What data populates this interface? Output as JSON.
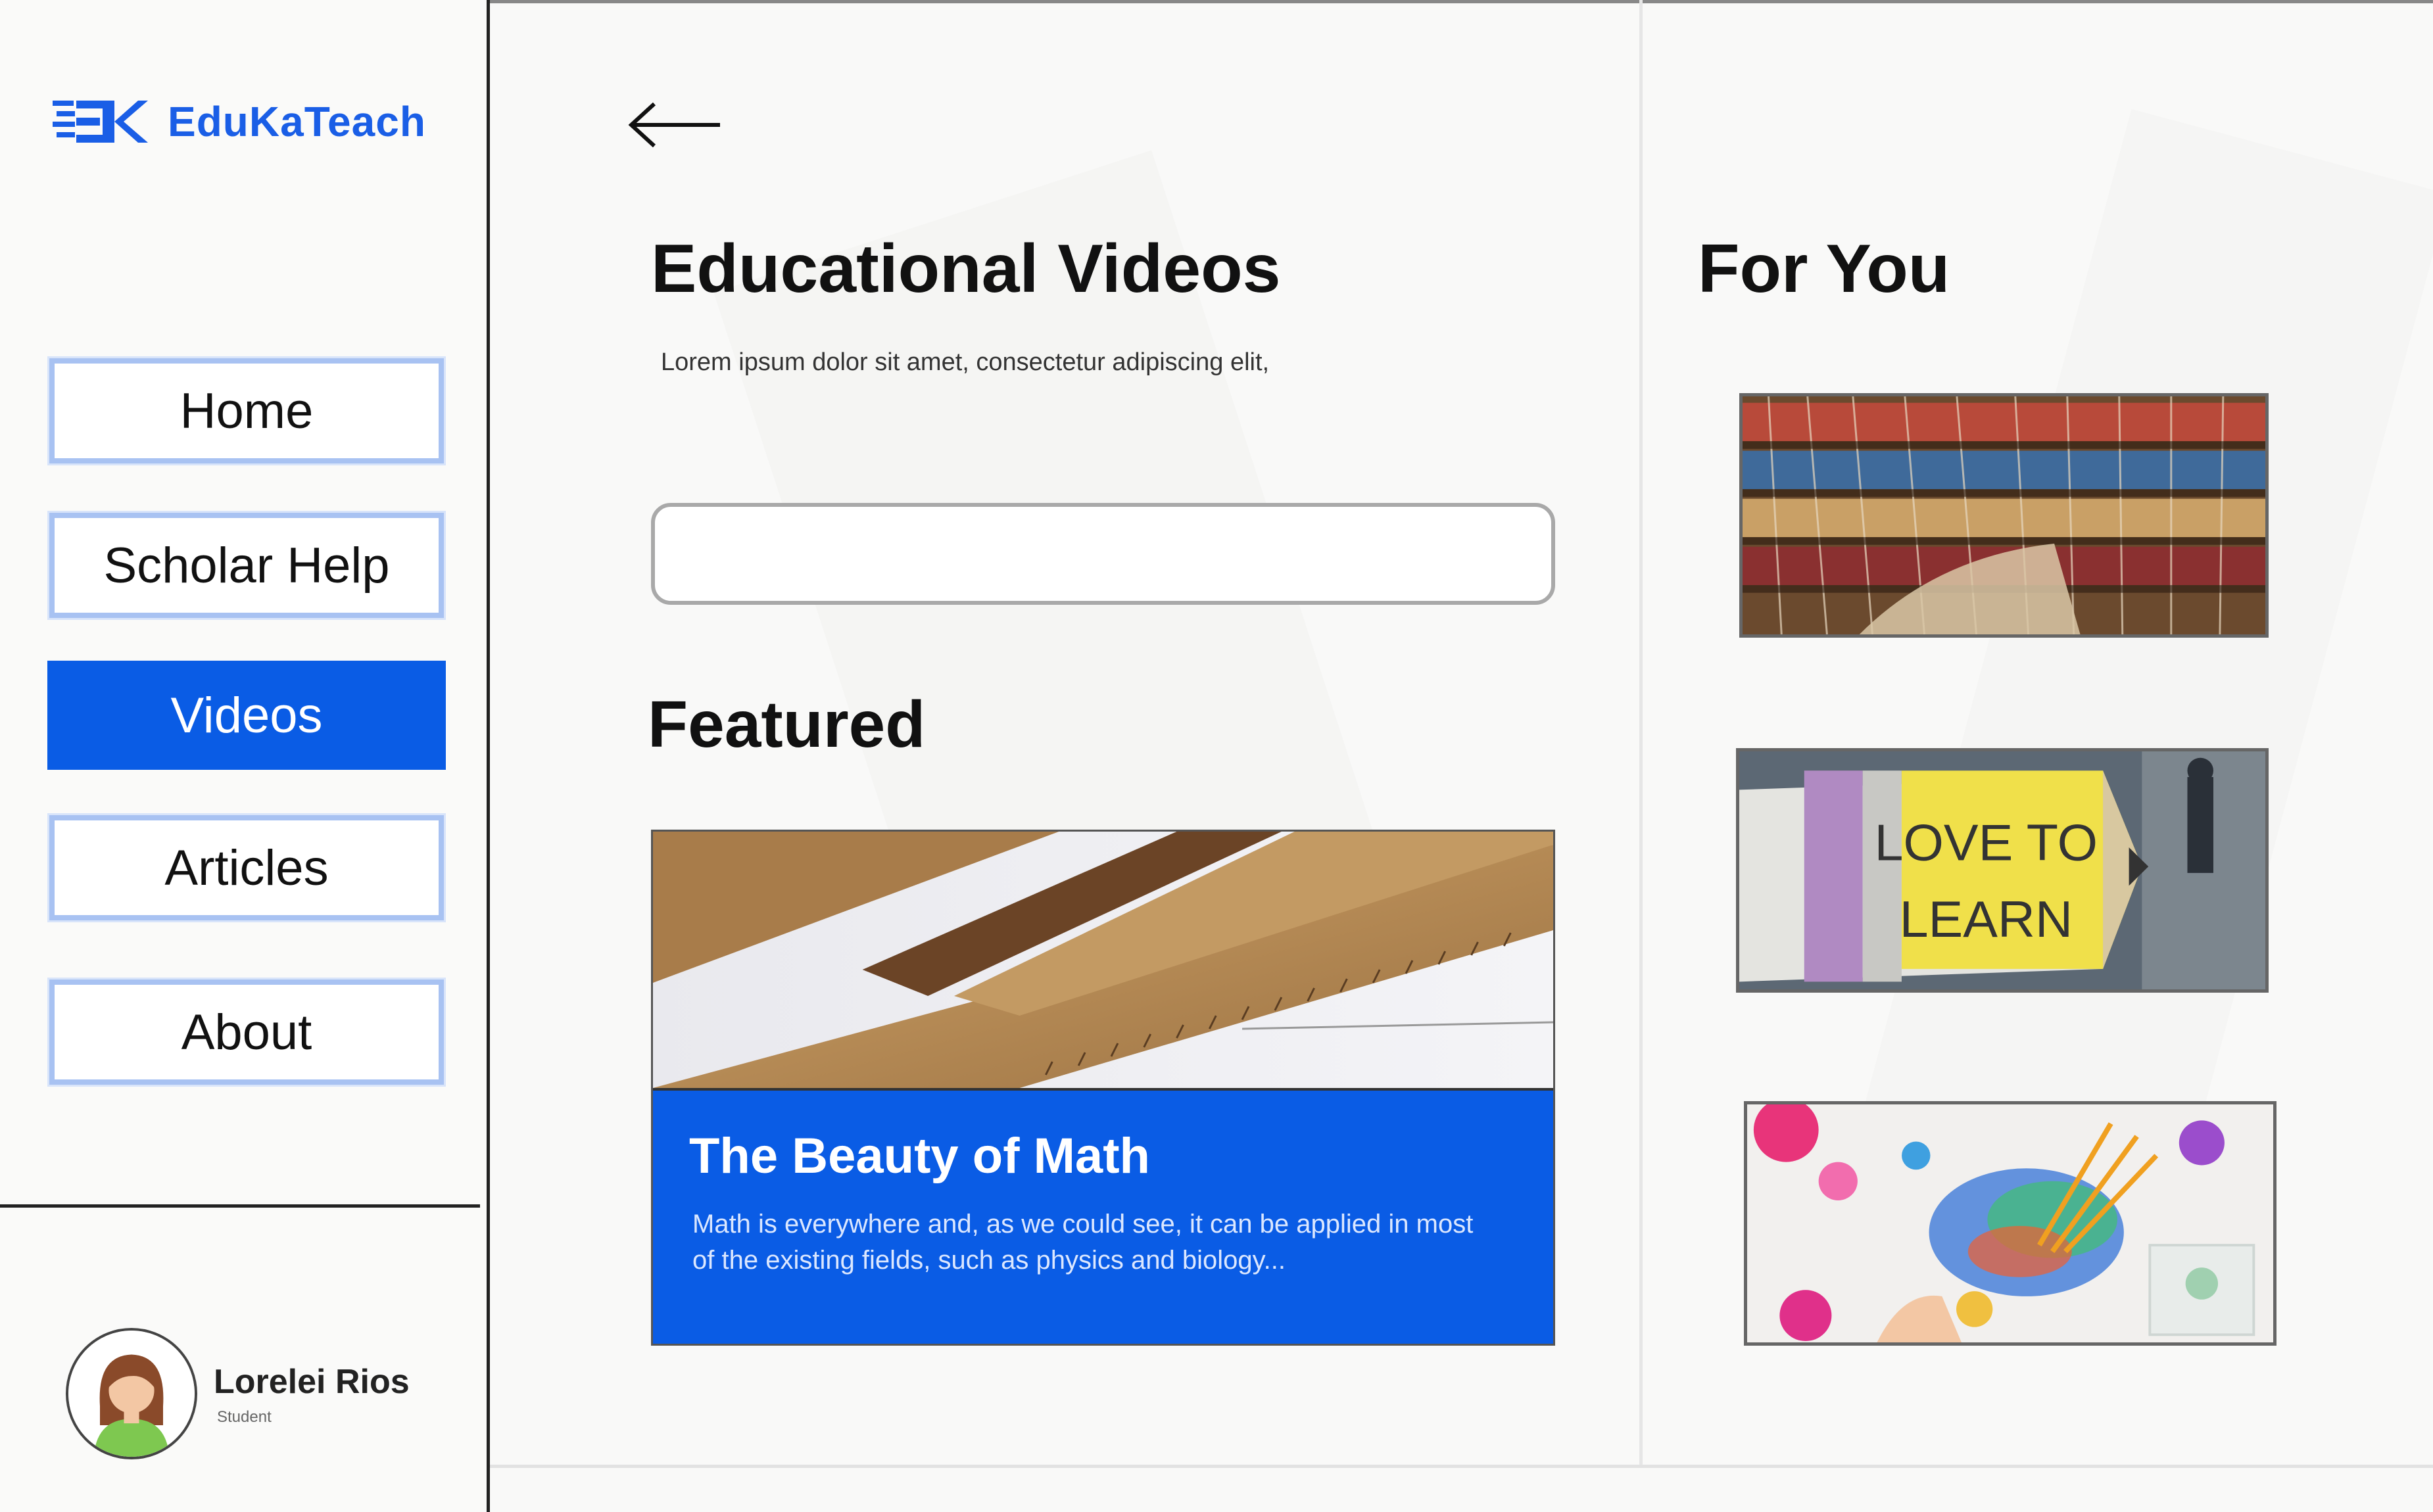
{
  "brand": {
    "name": "EduKaTeach",
    "logo_icon": "ek-logo-icon",
    "color": "#1a5ee6"
  },
  "sidebar": {
    "items": [
      {
        "label": "Home",
        "active": false
      },
      {
        "label": "Scholar  Help",
        "active": false
      },
      {
        "label": "Videos",
        "active": true
      },
      {
        "label": "Articles",
        "active": false
      },
      {
        "label": "About",
        "active": false
      }
    ]
  },
  "user": {
    "name": "Lorelei Rios",
    "role": "Student",
    "avatar_icon": "user-avatar-icon"
  },
  "main": {
    "back_icon": "arrow-left-icon",
    "title": "Educational Videos",
    "description": "Lorem ipsum dolor sit amet, consectetur adipiscing elit,",
    "search": {
      "value": "",
      "placeholder": ""
    },
    "featured_heading": "Featured",
    "featured_card": {
      "title": "The Beauty of Math",
      "description": "Math is everywhere and, as we could see, it can be applied in most of the existing fields, such as physics and biology...",
      "image": "wooden-rulers-image"
    }
  },
  "for_you": {
    "heading": "For You",
    "items": [
      {
        "image": "library-bookshelves-image"
      },
      {
        "image": "love-to-learn-pencil-image"
      },
      {
        "image": "paint-splatter-image"
      }
    ]
  },
  "colors": {
    "accent": "#0a5ce5",
    "button_border": "#a8c2f2",
    "background": "#f9f9f8"
  }
}
